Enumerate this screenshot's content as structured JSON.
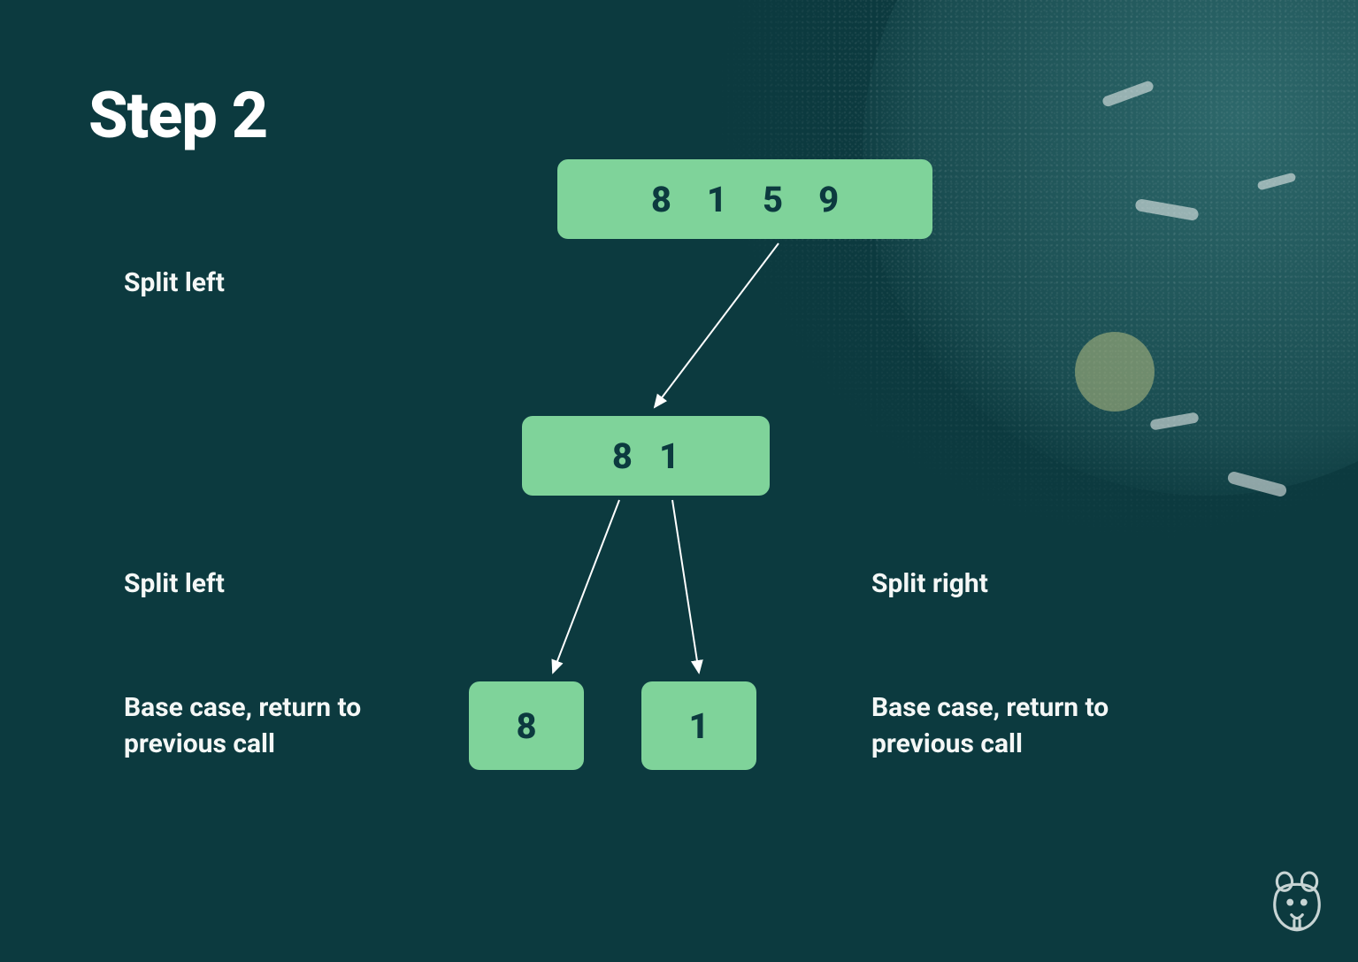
{
  "title": "Step 2",
  "colors": {
    "background": "#0c3a3f",
    "node": "#7fd39a",
    "text_light": "#f4f7f6",
    "text_dark": "#0c3a3f"
  },
  "labels": {
    "split_left_1": "Split left",
    "split_left_2": "Split left",
    "split_right": "Split right",
    "base_case_left": "Base case, return to previous call",
    "base_case_right": "Base case, return to previous call"
  },
  "nodes": {
    "root": {
      "values": [
        8,
        1,
        5,
        9
      ]
    },
    "mid": {
      "values": [
        8,
        1
      ]
    },
    "leaf_left": {
      "values": [
        8
      ]
    },
    "leaf_right": {
      "values": [
        1
      ]
    }
  },
  "logo_name": "beaver-logo"
}
